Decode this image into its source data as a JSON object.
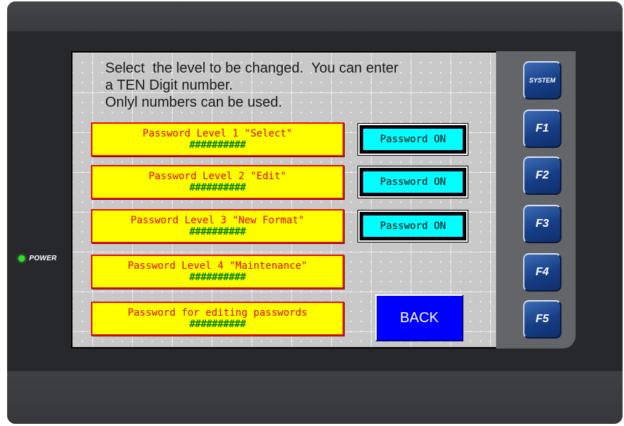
{
  "device": {
    "power_label": "POWER"
  },
  "screen": {
    "instructions": [
      "Select  the level to be changed.  You can enter",
      "a TEN Digit number.",
      "Onlyl numbers can be used."
    ],
    "password_buttons": [
      {
        "label": "Password Level 1 \"Select\"",
        "value": "##########"
      },
      {
        "label": "Password Level 2 \"Edit\"",
        "value": "##########"
      },
      {
        "label": "Password Level 3 \"New Format\"",
        "value": "##########"
      },
      {
        "label": "Password Level 4 \"Maintenance\"",
        "value": "##########"
      },
      {
        "label": "Password for editing passwords",
        "value": "##########"
      }
    ],
    "toggle_buttons": [
      {
        "label": "Password ON"
      },
      {
        "label": "Password ON"
      },
      {
        "label": "Password ON"
      }
    ],
    "back_label": "BACK"
  },
  "function_keys": [
    "SYSTEM",
    "F1",
    "F2",
    "F3",
    "F4",
    "F5"
  ],
  "colors": {
    "screen_bg": "#c8c8c8",
    "password_button_bg": "#ffff00",
    "password_label_text": "#e00000",
    "password_value_text": "#008000",
    "toggle_bg": "#00ffff",
    "back_bg": "#0000ff",
    "function_key_bg": "#1e4a94",
    "power_led": "#2ee02e"
  }
}
